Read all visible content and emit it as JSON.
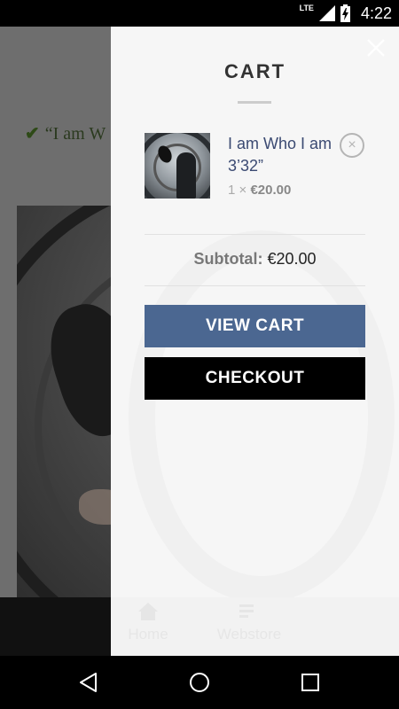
{
  "status_bar": {
    "network": "LTE",
    "time": "4:22",
    "icons": [
      "signal-icon",
      "battery-charging-icon"
    ]
  },
  "background_page": {
    "notice_text": "“I am W",
    "notice_icon": "checkmark-icon",
    "bottom_nav": {
      "home_label": "Home",
      "webstore_label": "Webstore"
    }
  },
  "cart": {
    "title": "CART",
    "close_icon": "close-icon",
    "items": [
      {
        "name": "I am Who I am 3’32”",
        "quantity": "1 ×",
        "price": "€20.00",
        "remove_icon": "remove-icon"
      }
    ],
    "subtotal_label": "Subtotal:",
    "subtotal_value": "€20.00",
    "view_cart_label": "VIEW CART",
    "checkout_label": "CHECKOUT"
  },
  "colors": {
    "view_cart_button": "#4b6791",
    "checkout_button": "#000000",
    "item_link": "#3b4a72",
    "drawer_background": "#f6f6f6"
  }
}
